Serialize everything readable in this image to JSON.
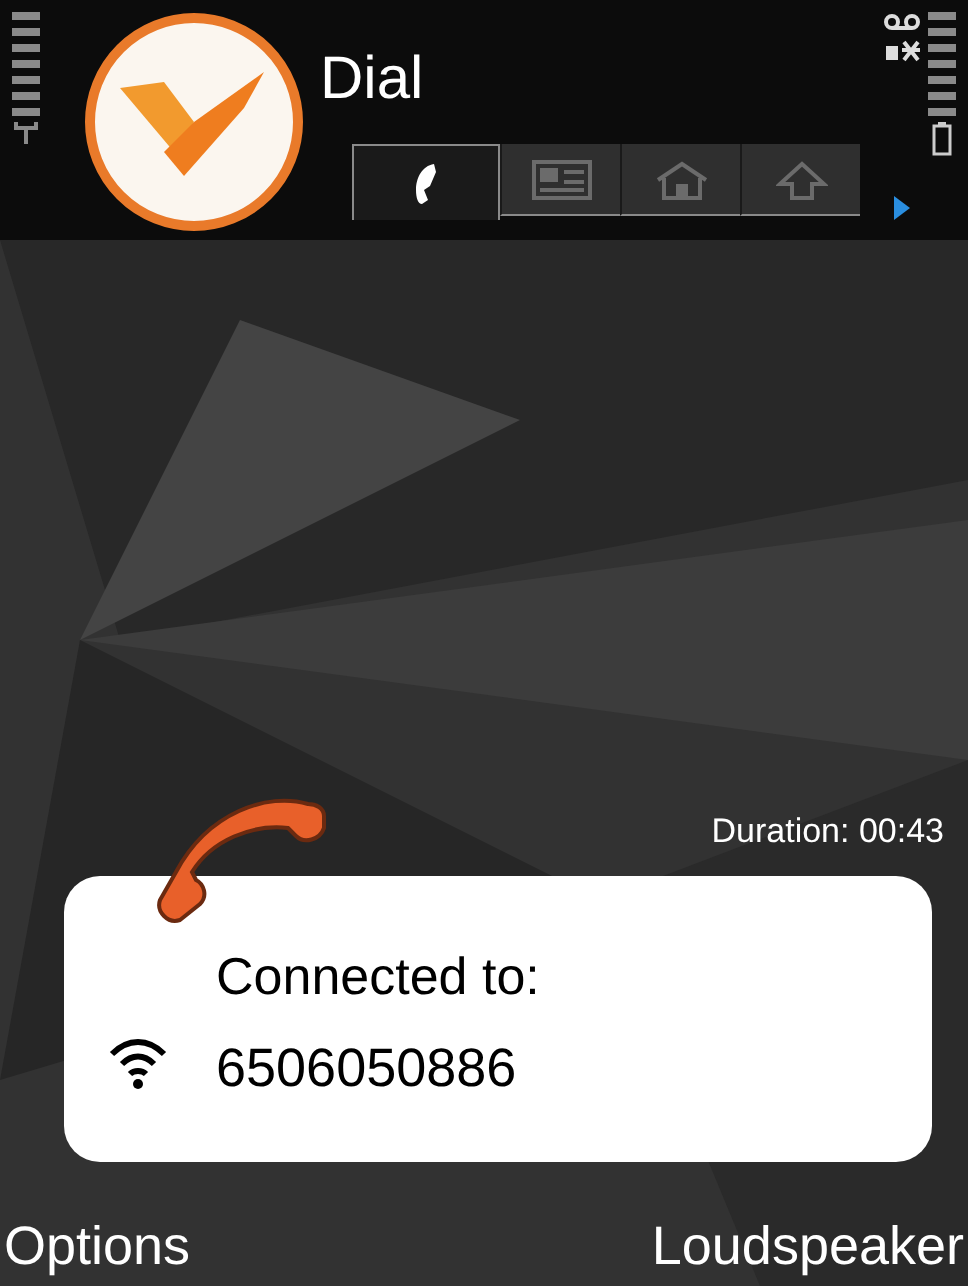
{
  "title": "Dial",
  "tabs": [
    {
      "kind": "phone",
      "selected": true
    },
    {
      "kind": "card",
      "selected": false
    },
    {
      "kind": "contacts",
      "selected": false
    },
    {
      "kind": "upload",
      "selected": false
    }
  ],
  "duration": "Duration: 00:43",
  "call": {
    "status": "Connected to:",
    "number": "6506050886"
  },
  "softkeys": {
    "left": "Options",
    "right": "Loudspeaker"
  }
}
